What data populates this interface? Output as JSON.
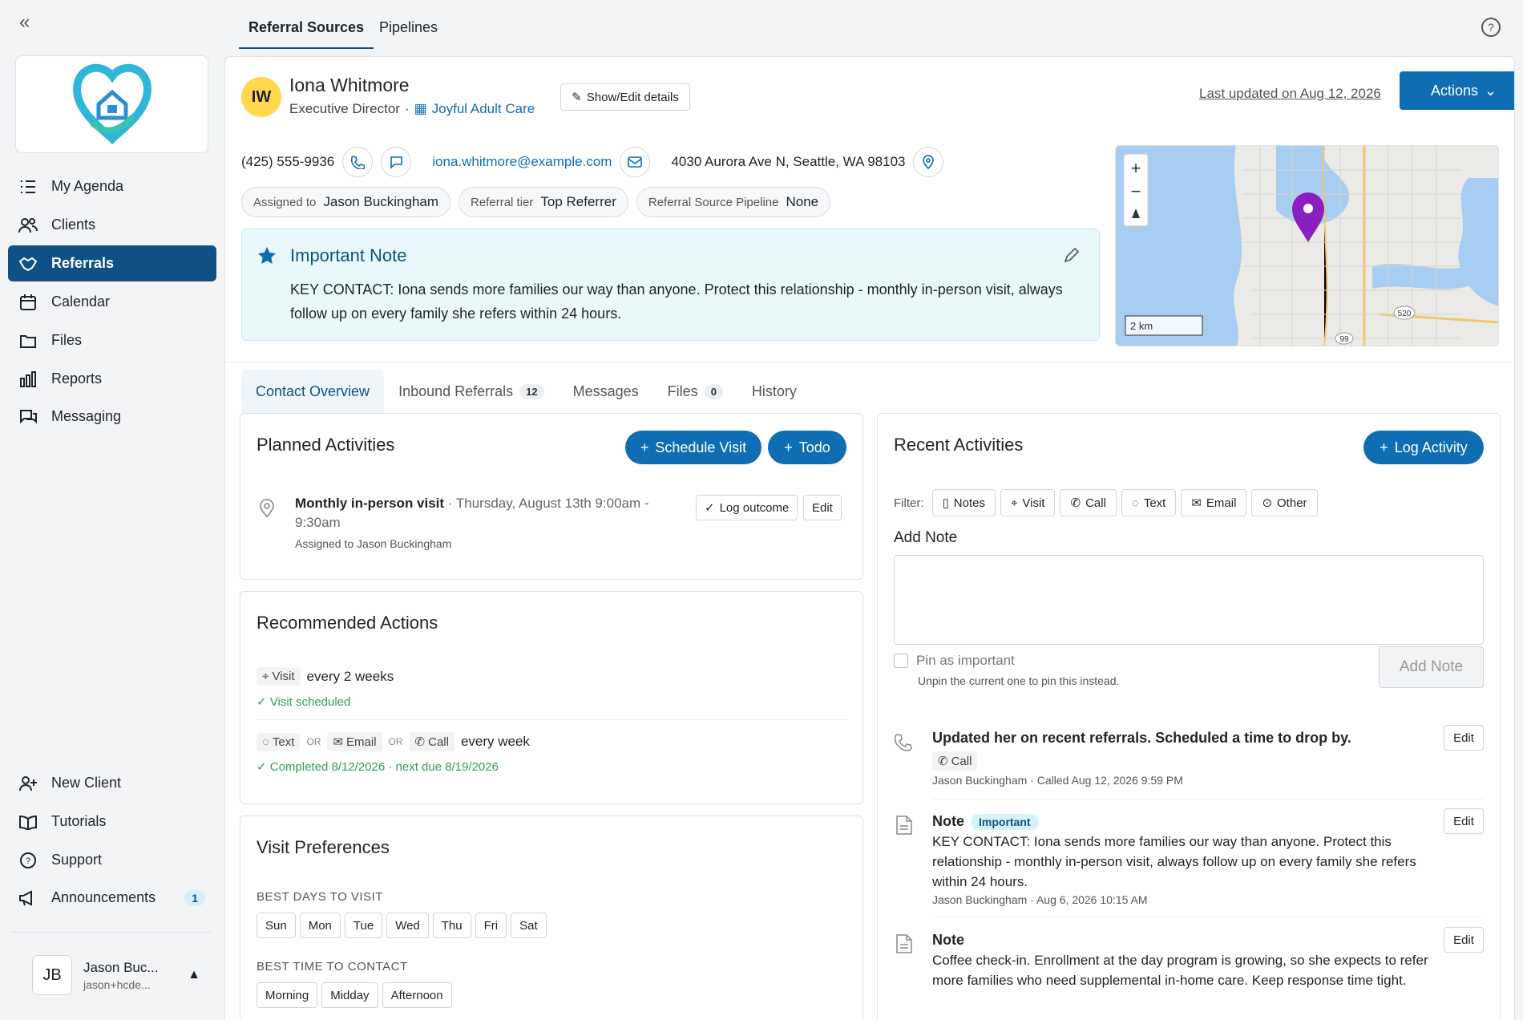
{
  "top_tabs": [
    "Referral Sources",
    "Pipelines"
  ],
  "sidebar": {
    "items": [
      {
        "label": "My Agenda"
      },
      {
        "label": "Clients"
      },
      {
        "label": "Referrals"
      },
      {
        "label": "Calendar"
      },
      {
        "label": "Files"
      },
      {
        "label": "Reports"
      },
      {
        "label": "Messaging"
      }
    ],
    "bottom_items": [
      {
        "label": "New Client"
      },
      {
        "label": "Tutorials"
      },
      {
        "label": "Support"
      },
      {
        "label": "Announcements",
        "badge": "1"
      }
    ],
    "user": {
      "initials": "JB",
      "name": "Jason Buc...",
      "email": "jason+hcde..."
    }
  },
  "profile": {
    "initials": "IW",
    "name": "Iona Whitmore",
    "role": "Executive Director",
    "separator": "·",
    "org": "Joyful Adult Care",
    "show_edit": "Show/Edit details",
    "last_updated": "Last updated on Aug 12, 2026",
    "actions": "Actions",
    "phone": "(425) 555-9936",
    "email": "iona.whitmore@example.com",
    "address": "4030 Aurora Ave N, Seattle, WA 98103",
    "assigned_label": "Assigned to",
    "assigned_value": "Jason Buckingham",
    "tier_label": "Referral tier",
    "tier_value": "Top Referrer",
    "pipeline_label": "Referral Source Pipeline",
    "pipeline_value": "None"
  },
  "important_note": {
    "title": "Important Note",
    "text": "KEY CONTACT: Iona sends more families our way than anyone. Protect this relationship - monthly in-person visit, always follow up on every family she refers within 24 hours."
  },
  "map": {
    "scale": "2 km",
    "road_labels": [
      "520",
      "99"
    ]
  },
  "content_tabs": [
    {
      "label": "Contact Overview"
    },
    {
      "label": "Inbound Referrals",
      "count": "12"
    },
    {
      "label": "Messages"
    },
    {
      "label": "Files",
      "count": "0"
    },
    {
      "label": "History"
    }
  ],
  "planned": {
    "title": "Planned Activities",
    "schedule_visit": "Schedule Visit",
    "todo": "Todo",
    "item_title": "Monthly in-person visit",
    "item_time_a": " · Thursday, August 13th 9:00am -",
    "item_time_b": "9:30am",
    "item_assigned": "Assigned to Jason Buckingham",
    "log_outcome": "Log outcome",
    "edit": "Edit"
  },
  "recommended": {
    "title": "Recommended Actions",
    "r1_tag": "Visit",
    "r1_freq": "every 2 weeks",
    "r1_status": "Visit scheduled",
    "r2_tags": [
      "Text",
      "Email",
      "Call"
    ],
    "or": "OR",
    "r2_freq": "every week",
    "r2_status": "Completed 8/12/2026 · next due 8/19/2026"
  },
  "preferences": {
    "title": "Visit Preferences",
    "days_label": "BEST DAYS TO VISIT",
    "days": [
      "Sun",
      "Mon",
      "Tue",
      "Wed",
      "Thu",
      "Fri",
      "Sat"
    ],
    "time_label": "BEST TIME TO CONTACT",
    "times": [
      "Morning",
      "Midday",
      "Afternoon"
    ]
  },
  "recent": {
    "title": "Recent Activities",
    "log_activity": "Log Activity",
    "filter_label": "Filter:",
    "filters": [
      "Notes",
      "Visit",
      "Call",
      "Text",
      "Email",
      "Other"
    ],
    "add_note_label": "Add Note",
    "pin_label": "Pin as important",
    "pin_hint": "Unpin the current one to pin this instead.",
    "add_note_btn": "Add Note",
    "activities": [
      {
        "title": "Updated her on recent referrals. Scheduled a time to drop by.",
        "tag": "Call",
        "meta": "Jason Buckingham · Called Aug 12, 2026 9:59 PM",
        "edit": "Edit"
      },
      {
        "title": "Note",
        "badge": "Important",
        "body": "KEY CONTACT: Iona sends more families our way than anyone. Protect this relationship - monthly in-person visit, always follow up on every family she refers within 24 hours.",
        "meta": "Jason Buckingham · Aug 6, 2026 10:15 AM",
        "edit": "Edit"
      },
      {
        "title": "Note",
        "body": "Coffee check-in. Enrollment at the day program is growing, so she expects to refer more families who need supplemental in-home care. Keep response time tight.",
        "edit": "Edit"
      }
    ]
  },
  "colors": {
    "primary": "#0f6db3",
    "nav_active": "#0f5185",
    "note_bg": "#e9f8fb",
    "avatar_yellow": "#ffd84d",
    "success": "#2e9d5a",
    "pin_purple": "#8a1fbf"
  }
}
